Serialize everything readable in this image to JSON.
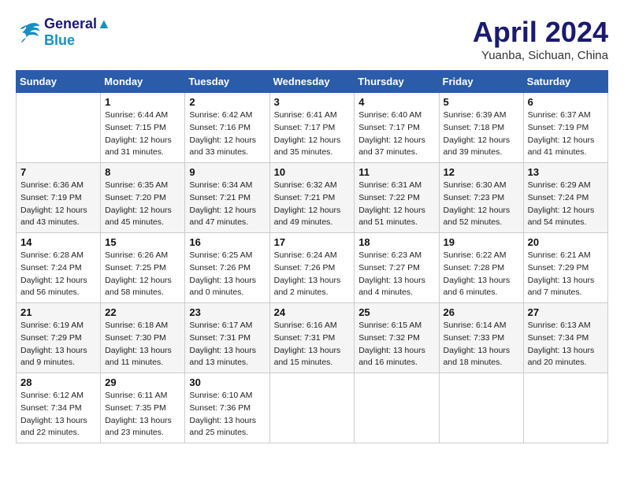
{
  "header": {
    "logo_line1": "General",
    "logo_line2": "Blue",
    "month_title": "April 2024",
    "location": "Yuanba, Sichuan, China"
  },
  "weekdays": [
    "Sunday",
    "Monday",
    "Tuesday",
    "Wednesday",
    "Thursday",
    "Friday",
    "Saturday"
  ],
  "weeks": [
    [
      {
        "day": "",
        "info": ""
      },
      {
        "day": "1",
        "info": "Sunrise: 6:44 AM\nSunset: 7:15 PM\nDaylight: 12 hours\nand 31 minutes."
      },
      {
        "day": "2",
        "info": "Sunrise: 6:42 AM\nSunset: 7:16 PM\nDaylight: 12 hours\nand 33 minutes."
      },
      {
        "day": "3",
        "info": "Sunrise: 6:41 AM\nSunset: 7:17 PM\nDaylight: 12 hours\nand 35 minutes."
      },
      {
        "day": "4",
        "info": "Sunrise: 6:40 AM\nSunset: 7:17 PM\nDaylight: 12 hours\nand 37 minutes."
      },
      {
        "day": "5",
        "info": "Sunrise: 6:39 AM\nSunset: 7:18 PM\nDaylight: 12 hours\nand 39 minutes."
      },
      {
        "day": "6",
        "info": "Sunrise: 6:37 AM\nSunset: 7:19 PM\nDaylight: 12 hours\nand 41 minutes."
      }
    ],
    [
      {
        "day": "7",
        "info": "Sunrise: 6:36 AM\nSunset: 7:19 PM\nDaylight: 12 hours\nand 43 minutes."
      },
      {
        "day": "8",
        "info": "Sunrise: 6:35 AM\nSunset: 7:20 PM\nDaylight: 12 hours\nand 45 minutes."
      },
      {
        "day": "9",
        "info": "Sunrise: 6:34 AM\nSunset: 7:21 PM\nDaylight: 12 hours\nand 47 minutes."
      },
      {
        "day": "10",
        "info": "Sunrise: 6:32 AM\nSunset: 7:21 PM\nDaylight: 12 hours\nand 49 minutes."
      },
      {
        "day": "11",
        "info": "Sunrise: 6:31 AM\nSunset: 7:22 PM\nDaylight: 12 hours\nand 51 minutes."
      },
      {
        "day": "12",
        "info": "Sunrise: 6:30 AM\nSunset: 7:23 PM\nDaylight: 12 hours\nand 52 minutes."
      },
      {
        "day": "13",
        "info": "Sunrise: 6:29 AM\nSunset: 7:24 PM\nDaylight: 12 hours\nand 54 minutes."
      }
    ],
    [
      {
        "day": "14",
        "info": "Sunrise: 6:28 AM\nSunset: 7:24 PM\nDaylight: 12 hours\nand 56 minutes."
      },
      {
        "day": "15",
        "info": "Sunrise: 6:26 AM\nSunset: 7:25 PM\nDaylight: 12 hours\nand 58 minutes."
      },
      {
        "day": "16",
        "info": "Sunrise: 6:25 AM\nSunset: 7:26 PM\nDaylight: 13 hours\nand 0 minutes."
      },
      {
        "day": "17",
        "info": "Sunrise: 6:24 AM\nSunset: 7:26 PM\nDaylight: 13 hours\nand 2 minutes."
      },
      {
        "day": "18",
        "info": "Sunrise: 6:23 AM\nSunset: 7:27 PM\nDaylight: 13 hours\nand 4 minutes."
      },
      {
        "day": "19",
        "info": "Sunrise: 6:22 AM\nSunset: 7:28 PM\nDaylight: 13 hours\nand 6 minutes."
      },
      {
        "day": "20",
        "info": "Sunrise: 6:21 AM\nSunset: 7:29 PM\nDaylight: 13 hours\nand 7 minutes."
      }
    ],
    [
      {
        "day": "21",
        "info": "Sunrise: 6:19 AM\nSunset: 7:29 PM\nDaylight: 13 hours\nand 9 minutes."
      },
      {
        "day": "22",
        "info": "Sunrise: 6:18 AM\nSunset: 7:30 PM\nDaylight: 13 hours\nand 11 minutes."
      },
      {
        "day": "23",
        "info": "Sunrise: 6:17 AM\nSunset: 7:31 PM\nDaylight: 13 hours\nand 13 minutes."
      },
      {
        "day": "24",
        "info": "Sunrise: 6:16 AM\nSunset: 7:31 PM\nDaylight: 13 hours\nand 15 minutes."
      },
      {
        "day": "25",
        "info": "Sunrise: 6:15 AM\nSunset: 7:32 PM\nDaylight: 13 hours\nand 16 minutes."
      },
      {
        "day": "26",
        "info": "Sunrise: 6:14 AM\nSunset: 7:33 PM\nDaylight: 13 hours\nand 18 minutes."
      },
      {
        "day": "27",
        "info": "Sunrise: 6:13 AM\nSunset: 7:34 PM\nDaylight: 13 hours\nand 20 minutes."
      }
    ],
    [
      {
        "day": "28",
        "info": "Sunrise: 6:12 AM\nSunset: 7:34 PM\nDaylight: 13 hours\nand 22 minutes."
      },
      {
        "day": "29",
        "info": "Sunrise: 6:11 AM\nSunset: 7:35 PM\nDaylight: 13 hours\nand 23 minutes."
      },
      {
        "day": "30",
        "info": "Sunrise: 6:10 AM\nSunset: 7:36 PM\nDaylight: 13 hours\nand 25 minutes."
      },
      {
        "day": "",
        "info": ""
      },
      {
        "day": "",
        "info": ""
      },
      {
        "day": "",
        "info": ""
      },
      {
        "day": "",
        "info": ""
      }
    ]
  ]
}
